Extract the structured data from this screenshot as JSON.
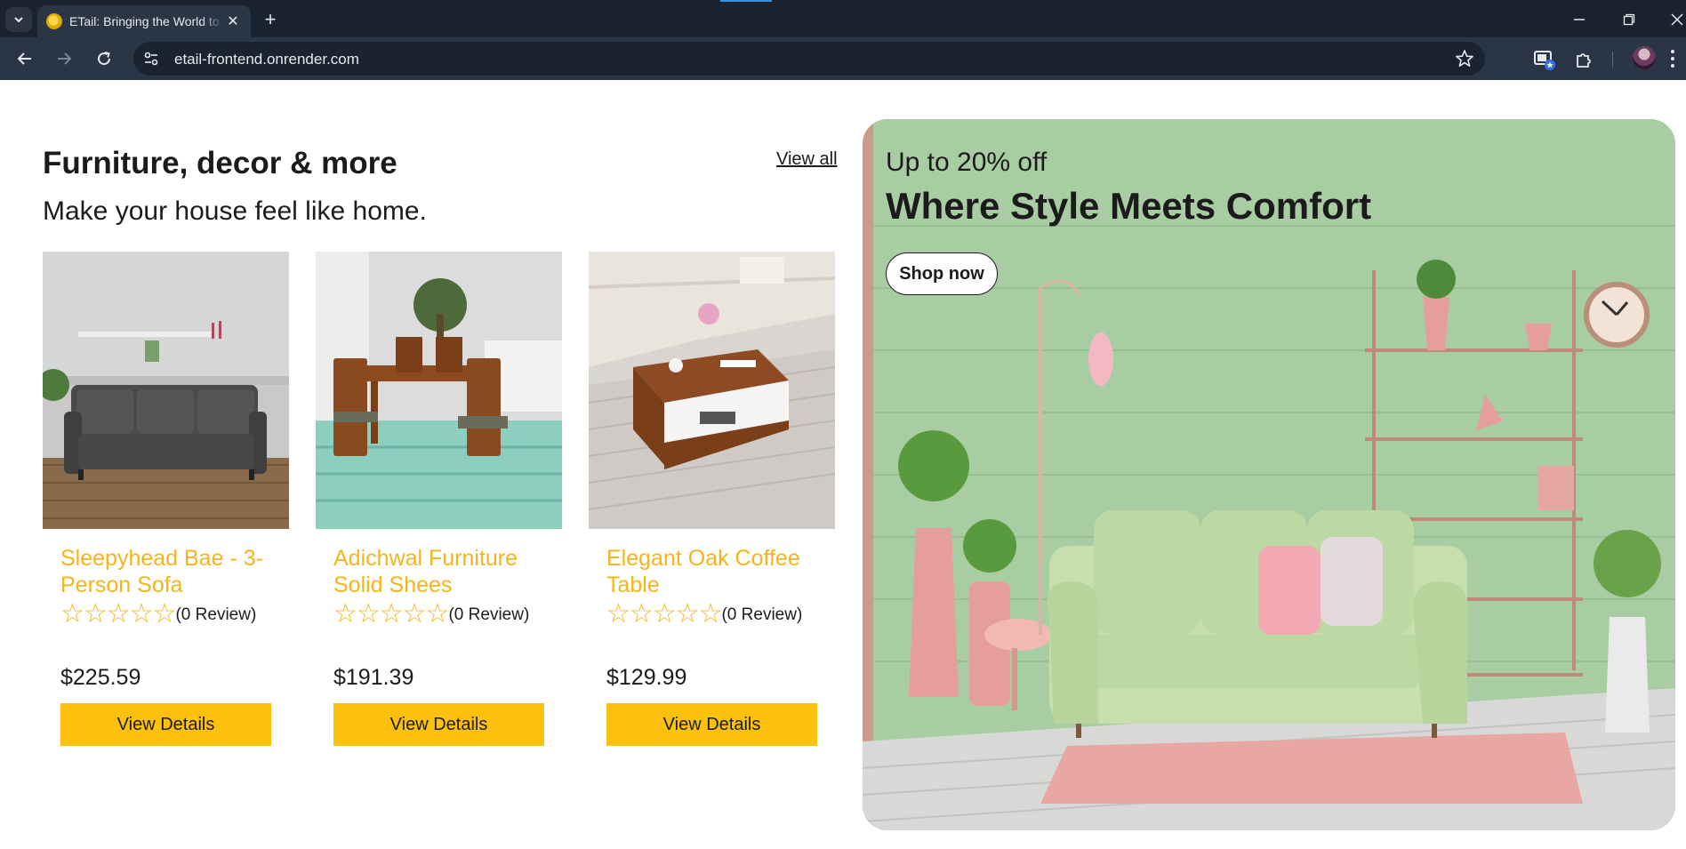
{
  "browser": {
    "tab_title": "ETail: Bringing the World to You",
    "url": "etail-frontend.onrender.com",
    "new_tab_symbol": "+",
    "close_symbol": "✕"
  },
  "section": {
    "title": "Furniture, decor & more",
    "subtitle": "Make your house feel like home.",
    "view_all": "View all"
  },
  "products": [
    {
      "name": "Sleepyhead Bae - 3-Person Sofa",
      "stars": "☆☆☆☆☆",
      "reviews": "(0 Review)",
      "price": "$225.59",
      "button": "View Details"
    },
    {
      "name": "Adichwal Furniture Solid Shees",
      "stars": "☆☆☆☆☆",
      "reviews": "(0 Review)",
      "price": "$191.39",
      "button": "View Details"
    },
    {
      "name": "Elegant Oak Coffee Table",
      "stars": "☆☆☆☆☆",
      "reviews": "(0 Review)",
      "price": "$129.99",
      "button": "View Details"
    }
  ],
  "banner": {
    "promo": "Up to 20% off",
    "headline": "Where Style Meets Comfort",
    "cta": "Shop now"
  },
  "colors": {
    "accent": "#fcc10e",
    "product_name": "#f3b51a",
    "chrome_dark": "#1a2330",
    "chrome_toolbar": "#2a3646",
    "banner_green": "#9fc69a"
  },
  "icons": [
    "tab-search-icon",
    "site-favicon",
    "close-icon",
    "plus-icon",
    "minimize-icon",
    "restore-icon",
    "back-icon",
    "forward-icon",
    "reload-icon",
    "site-info-icon",
    "star-icon",
    "cast-icon",
    "extensions-icon",
    "avatar",
    "menu-icon"
  ]
}
